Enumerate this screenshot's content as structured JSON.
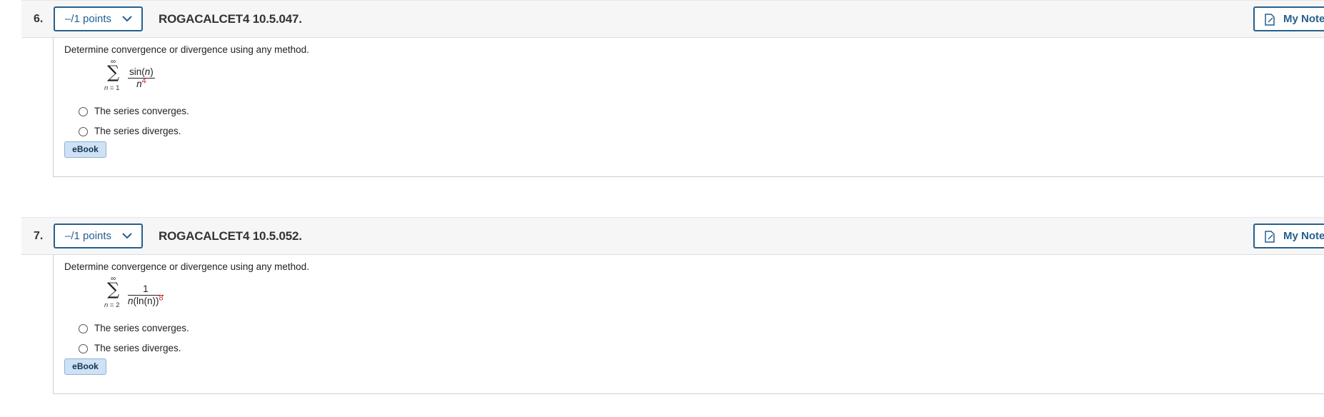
{
  "questions": [
    {
      "number": "6.",
      "points_label": "–/1 points",
      "question_id": "ROGACALCET4 10.5.047.",
      "notes_label": "My Notes",
      "prompt": "Determine convergence or divergence using any method.",
      "sum": {
        "upper": "∞",
        "sigma": "∑",
        "lower_var": "n",
        "lower_rest": " = 1",
        "numerator_pre": "sin(",
        "numerator_var": "n",
        "numerator_post": ")",
        "denominator_pre": "",
        "denominator_var": "n",
        "denominator_post": "",
        "exponent": "4"
      },
      "options": [
        "The series converges.",
        "The series diverges."
      ],
      "ebook_label": "eBook"
    },
    {
      "number": "7.",
      "points_label": "–/1 points",
      "question_id": "ROGACALCET4 10.5.052.",
      "notes_label": "My Notes",
      "prompt": "Determine convergence or divergence using any method.",
      "sum": {
        "upper": "∞",
        "sigma": "∑",
        "lower_var": "n",
        "lower_rest": " = 2",
        "numerator": "1",
        "denominator_var": "n",
        "denominator_post": "(ln(n))",
        "exponent": "8"
      },
      "options": [
        "The series converges.",
        "The series diverges."
      ],
      "ebook_label": "eBook"
    }
  ],
  "colors": {
    "accent": "#245f8f",
    "exponent": "#e0201c",
    "header_bg": "#f6f6f6",
    "ebook_bg": "#cfe1f4"
  },
  "icons": {
    "points_dropdown": "chevron-down-icon",
    "notes": "document-pencil-icon"
  }
}
